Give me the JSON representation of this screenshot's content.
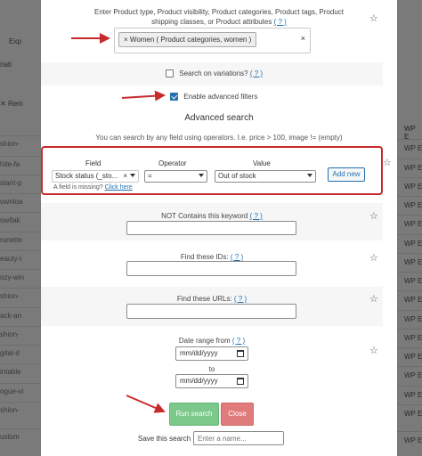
{
  "background": {
    "left_labels": [
      "Exp",
      "riati",
      "Rem"
    ],
    "left_rows": [
      "shion-",
      "hite-fa",
      "stant-p",
      "ownloa",
      "owflak",
      "runette",
      "eauty-i",
      "ozy-win",
      "shion-",
      "ack-an",
      "shion-",
      "gital-d",
      "intable",
      "ogue-vi",
      "shion-",
      "ustom"
    ],
    "right_header": "WP E",
    "right_rows": [
      "WP E",
      "WP E",
      "WP E",
      "WP E",
      "WP E",
      "WP E",
      "WP E",
      "WP E",
      "WP E",
      "WP E",
      "WP E",
      "WP E",
      "WP E",
      "WP E",
      "WP E",
      "WP E"
    ]
  },
  "product_types": {
    "description": "Enter Product type, Product visibility, Product categories, Product tags, Product shipping classes, or Product attributes",
    "help_link": "( ? )",
    "chip_label": "Women ( Product categories, women )",
    "chip_remove": "×",
    "clear": "×"
  },
  "search_variations": {
    "label": "Search on variations?",
    "help_link": "( ? )",
    "checked": false
  },
  "advanced_filters_toggle": {
    "label": "Enable advanced filters",
    "checked": true
  },
  "advanced_search": {
    "title": "Advanced search",
    "hint": "You can search by any field using operators. I.e. price > 100, image != (empty)",
    "field_header": "Field",
    "operator_header": "Operator",
    "value_header": "Value",
    "field_value": "Stock status (_sto...",
    "field_clear": "×",
    "operator_value": "=",
    "value_value": "Out of stock",
    "add_new_label": "Add new",
    "missing_text": "A field is missing?",
    "missing_link": "Click here"
  },
  "not_contains": {
    "label": "NOT Contains this keyword",
    "help_link": "( ? )",
    "value": ""
  },
  "find_ids": {
    "label": "Find these IDs:",
    "help_link": "( ? )",
    "value": ""
  },
  "find_urls": {
    "label": "Find these URLs:",
    "help_link": "( ? )",
    "value": ""
  },
  "date_range": {
    "label": "Date range from",
    "help_link": "( ? )",
    "from_placeholder": "mm/dd/yyyy",
    "to_label": "to",
    "to_placeholder": "mm/dd/yyyy"
  },
  "actions": {
    "run_label": "Run search",
    "close_label": "Close"
  },
  "save_search": {
    "label": "Save this search",
    "placeholder": "Enter a name..."
  },
  "colors": {
    "annotation_red": "#c62b2b",
    "run_green": "#7bc88a",
    "close_red": "#e07b7b",
    "link_blue": "#1f6fb2"
  }
}
